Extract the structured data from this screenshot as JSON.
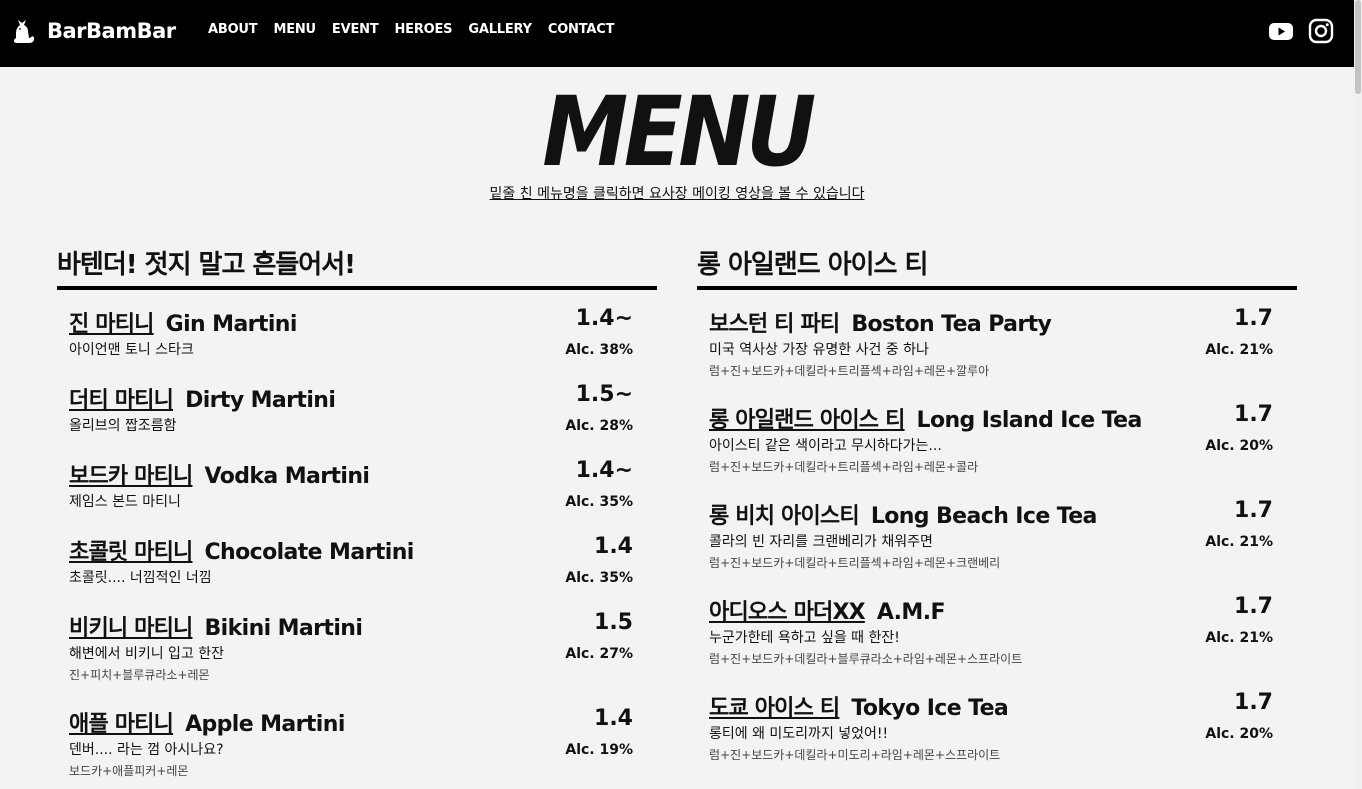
{
  "nav": {
    "brand": "BarBamBar",
    "links": [
      "ABOUT",
      "MENU",
      "EVENT",
      "HEROES",
      "GALLERY",
      "CONTACT"
    ]
  },
  "page": {
    "title": "MENU",
    "subtitle": "밑줄 친 메뉴명을 클릭하면 요사장 메이킹 영상을 볼 수 있습니다"
  },
  "sections": [
    {
      "title": "바텐더! 젓지 말고 흔들어서!",
      "items": [
        {
          "ko": "진 마티니",
          "en": "Gin Martini",
          "price": "1.4~",
          "desc": "아이언맨 토니 스타크",
          "alc": "Alc. 38%",
          "recipe": ""
        },
        {
          "ko": "더티 마티니",
          "en": "Dirty Martini",
          "price": "1.5~",
          "desc": "올리브의 짭조름함",
          "alc": "Alc. 28%",
          "recipe": ""
        },
        {
          "ko": "보드카 마티니",
          "en": "Vodka Martini",
          "price": "1.4~",
          "desc": "제임스 본드 마티니",
          "alc": "Alc. 35%",
          "recipe": ""
        },
        {
          "ko": "초콜릿 마티니",
          "en": "Chocolate Martini",
          "price": "1.4",
          "desc": "초콜릿.... 너낌적인 너낌",
          "alc": "Alc. 35%",
          "recipe": ""
        },
        {
          "ko": "비키니 마티니",
          "en": "Bikini Martini",
          "price": "1.5",
          "desc": "해변에서 비키니 입고 한잔",
          "alc": "Alc. 27%",
          "recipe": "진+피치+블루큐라소+레몬"
        },
        {
          "ko": "애플 마티니",
          "en": "Apple Martini",
          "price": "1.4",
          "desc": "덴버.... 라는 껌 아시나요?",
          "alc": "Alc. 19%",
          "recipe": "보드카+애플피커+레몬"
        }
      ]
    },
    {
      "title": "롱 아일랜드 아이스 티",
      "items": [
        {
          "ko": "보스턴 티 파티",
          "en": "Boston Tea Party",
          "price": "1.7",
          "desc": "미국 역사상 가장 유명한 사건 중 하나",
          "alc": "Alc. 21%",
          "recipe": "럼+진+보드카+데킬라+트리플섹+라임+레몬+깔루아"
        },
        {
          "ko": "롱 아일랜드 아이스 티",
          "en": "Long Island Ice Tea",
          "price": "1.7",
          "desc": "아이스티 같은 색이라고 무시하다가는...",
          "alc": "Alc. 20%",
          "recipe": "럼+진+보드카+데킬라+트리플섹+라임+레몬+콜라"
        },
        {
          "ko": "롱 비치 아이스티",
          "en": "Long Beach Ice Tea",
          "price": "1.7",
          "desc": "콜라의 빈 자리를 크랜베리가 채워주면",
          "alc": "Alc. 21%",
          "recipe": "럼+진+보드카+데킬라+트리플섹+라임+레몬+크랜베리"
        },
        {
          "ko": "아디오스 마더XX",
          "en": "A.M.F",
          "price": "1.7",
          "desc": "누군가한테 욕하고 싶을 때 한잔!",
          "alc": "Alc. 21%",
          "recipe": "럼+진+보드카+데킬라+블루큐라소+라임+레몬+스프라이트"
        },
        {
          "ko": "도쿄 아이스 티",
          "en": "Tokyo Ice Tea",
          "price": "1.7",
          "desc": "롱티에 왜 미도리까지 넣었어!!",
          "alc": "Alc. 20%",
          "recipe": "럼+진+보드카+데킬라+미도리+라임+레몬+스프라이트"
        }
      ]
    }
  ],
  "icons": {
    "brand": "cat-icon",
    "social": [
      "youtube-icon",
      "instagram-icon"
    ]
  },
  "colors": {
    "nav_bg": "#000000",
    "page_bg": "#f3f3f3",
    "text": "#111111"
  }
}
